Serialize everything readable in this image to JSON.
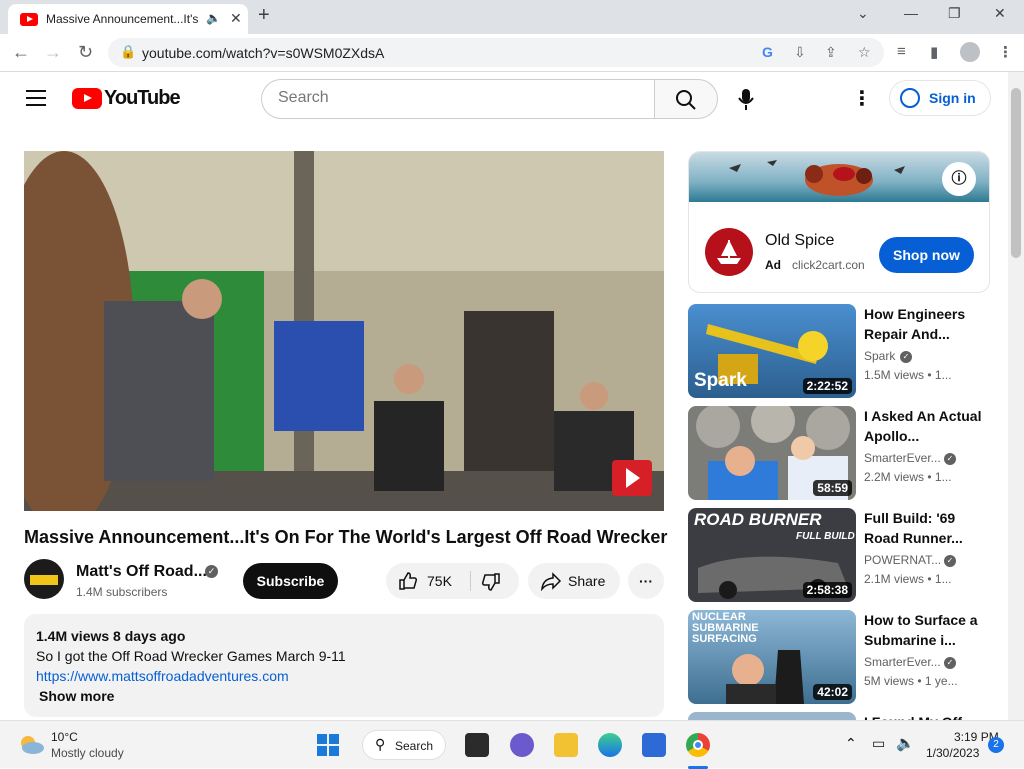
{
  "browser": {
    "tab_title": "Massive Announcement...It's",
    "url": "youtube.com/watch?v=s0WSM0ZXdsA"
  },
  "header": {
    "logo_text": "YouTube",
    "search_placeholder": "Search",
    "signin_label": "Sign in"
  },
  "video": {
    "title": "Massive Announcement...It's On For The World's Largest Off Road Wrecker",
    "channel_name": "Matt's Off Road...",
    "subscribers": "1.4M subscribers",
    "subscribe_label": "Subscribe",
    "likes": "75K",
    "share_label": "Share",
    "description": {
      "views_date": "1.4M views  8 days ago",
      "line1": "So I got the Off Road Wrecker Games March 9-11",
      "link": "https://www.mattsoffroadadventures.com",
      "show_more": "Show more"
    }
  },
  "ad": {
    "brand": "Old Spice",
    "tag": "Ad",
    "domain": "click2cart.con",
    "cta": "Shop now"
  },
  "recommendations": [
    {
      "title": "How Engineers Repair And...",
      "channel": "Spark",
      "views": "1.5M views",
      "age": "1...",
      "duration": "2:22:52",
      "thumb_label": "Spark"
    },
    {
      "title": "I Asked An Actual Apollo...",
      "channel": "SmarterEver...",
      "views": "2.2M views",
      "age": "1...",
      "duration": "58:59",
      "thumb_label": ""
    },
    {
      "title": "Full Build: '69 Road Runner...",
      "channel": "POWERNAT...",
      "views": "2.1M views",
      "age": "1...",
      "duration": "2:58:38",
      "thumb_label": "ROAD BURNER",
      "thumb_sub": "FULL BUILD"
    },
    {
      "title": "How to Surface a Submarine i...",
      "channel": "SmarterEver...",
      "views": "5M views",
      "age": "1 ye...",
      "duration": "42:02",
      "thumb_label": "NUCLEAR SUBMARINE SURFACING"
    },
    {
      "title": "I Found My Off..."
    }
  ],
  "taskbar": {
    "temperature": "10°C",
    "weather": "Mostly cloudy",
    "search_label": "Search",
    "time": "3:19 PM",
    "date": "1/30/2023",
    "notifications": "2"
  },
  "colors": {
    "youtube_red": "#ff0000",
    "link_blue": "#065fd4",
    "text_dark": "#0f0f0f",
    "text_muted": "#606060"
  }
}
